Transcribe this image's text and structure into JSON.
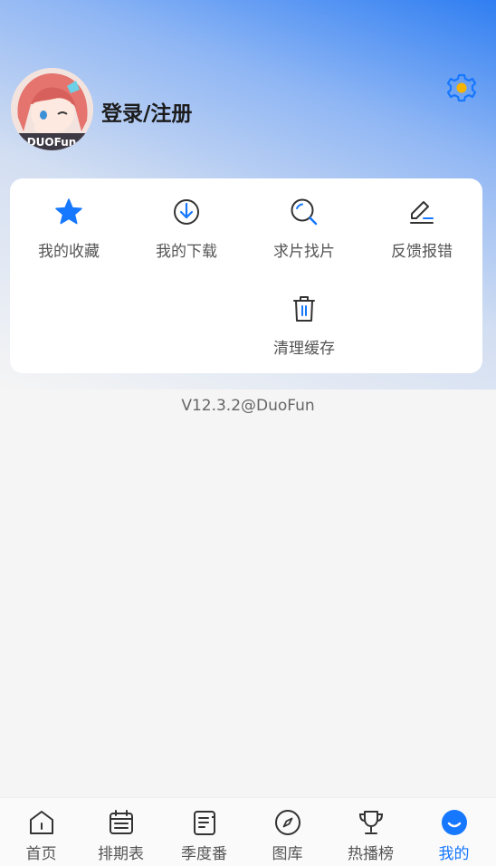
{
  "profile": {
    "login_label": "登录/注册",
    "avatar_watermark": "DUOFun"
  },
  "menu": {
    "items": [
      {
        "label": "我的收藏",
        "icon": "star-icon"
      },
      {
        "label": "我的下载",
        "icon": "download-icon"
      },
      {
        "label": "求片找片",
        "icon": "search-icon"
      },
      {
        "label": "反馈报错",
        "icon": "edit-icon"
      },
      {
        "label": "清理缓存",
        "icon": "trash-icon"
      }
    ]
  },
  "version": "V12.3.2@DuoFun",
  "tabs": [
    {
      "label": "首页",
      "icon": "home-icon"
    },
    {
      "label": "排期表",
      "icon": "calendar-icon"
    },
    {
      "label": "季度番",
      "icon": "news-icon"
    },
    {
      "label": "图库",
      "icon": "compass-icon"
    },
    {
      "label": "热播榜",
      "icon": "trophy-icon"
    },
    {
      "label": "我的",
      "icon": "profile-icon",
      "active": true
    }
  ],
  "colors": {
    "accent": "#1677ff",
    "settings_gear": "#1677ff",
    "settings_center": "#f5b400"
  }
}
